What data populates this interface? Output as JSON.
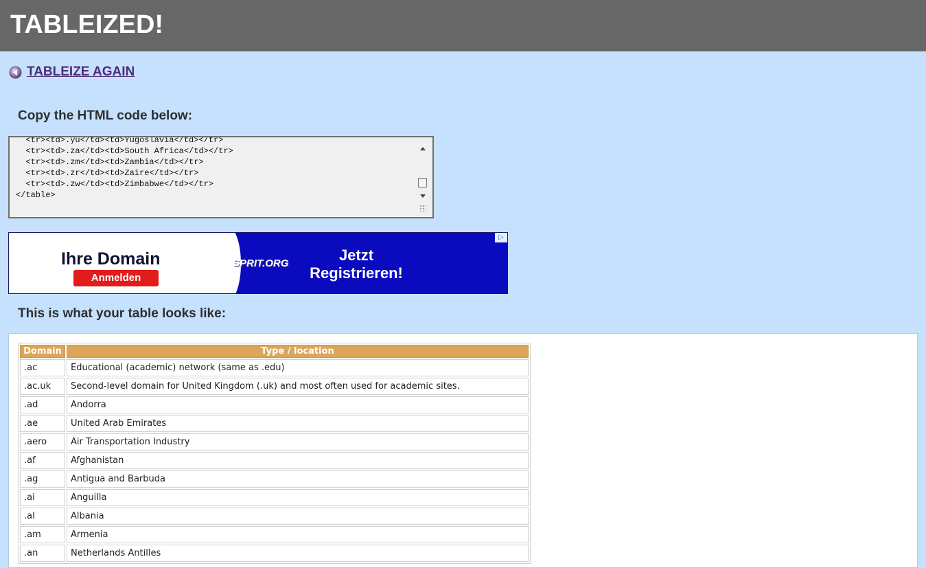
{
  "header": {
    "title": "TABLEIZED!"
  },
  "nav": {
    "back_label": "TABLEIZE AGAIN"
  },
  "code_section": {
    "heading": "Copy the HTML code below:",
    "code": "  <tr><td>.yu</td><td>Yugoslavia</td></tr>\n  <tr><td>.za</td><td>South Africa</td></tr>\n  <tr><td>.zm</td><td>Zambia</td></tr>\n  <tr><td>.zr</td><td>Zaire</td></tr>\n  <tr><td>.zw</td><td>Zimbabwe</td></tr>\n</table>"
  },
  "ad": {
    "title": "Ihre Domain",
    "button": "Anmelden",
    "brand": "SPRIT.ORG",
    "cta_line1": "Jetzt",
    "cta_line2": "Registrieren!",
    "choice_icon": "ad-choices-icon"
  },
  "preview_section": {
    "heading": "This is what your table looks like:"
  },
  "table": {
    "columns": [
      "Domain",
      "Type / location"
    ],
    "rows": [
      [
        ".ac",
        "Educational (academic) network (same as .edu)"
      ],
      [
        ".ac.uk",
        "Second-level domain for United Kingdom (.uk) and most often used for academic sites."
      ],
      [
        ".ad",
        "Andorra"
      ],
      [
        ".ae",
        "United Arab Emirates"
      ],
      [
        ".aero",
        "Air Transportation Industry"
      ],
      [
        ".af",
        "Afghanistan"
      ],
      [
        ".ag",
        "Antigua and Barbuda"
      ],
      [
        ".ai",
        "Anguilla"
      ],
      [
        ".al",
        "Albania"
      ],
      [
        ".am",
        "Armenia"
      ],
      [
        ".an",
        "Netherlands Antilles"
      ]
    ]
  },
  "colors": {
    "page_bg": "#c5e1fd",
    "header_bg": "#676767",
    "link": "#4f2b7c",
    "table_header": "#dba65a"
  }
}
